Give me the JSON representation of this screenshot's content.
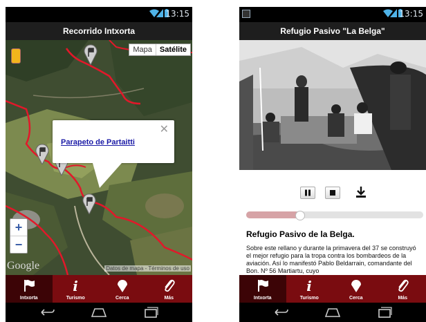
{
  "status": {
    "time": "13:15"
  },
  "screen1": {
    "title": "Recorrido Intxorta",
    "map_type": {
      "map": "Mapa",
      "satellite": "Satélite"
    },
    "popup": {
      "link": "Parapeto de Partaitti",
      "close": "✕"
    },
    "zoom": {
      "in": "+",
      "out": "−"
    },
    "google": "Google",
    "map_data": "Datos de mapa - Términos de uso"
  },
  "screen2": {
    "title": "Refugio Pasivo \"La Belga\"",
    "progress": 0.3,
    "section_title": "Refugio Pasivo de la Belga.",
    "body": "Sobre este rellano y durante la primavera del 37 se construyó el mejor refugio para la tropa contra los bombardeos de la aviación. Así lo manifestó Pablo Beldarrain, comandante del Bon. Nº 56 Martiartu, cuyo"
  },
  "tabs": [
    {
      "label": "Intxorta",
      "icon": "flag-icon"
    },
    {
      "label": "Turismo",
      "icon": "info-icon"
    },
    {
      "label": "Cerca",
      "icon": "map-pin-icon"
    },
    {
      "label": "Más",
      "icon": "paperclip-icon"
    }
  ],
  "colors": {
    "accent": "#7a0c10",
    "tab_selected": "#3c0406",
    "route": "#e2182a"
  }
}
